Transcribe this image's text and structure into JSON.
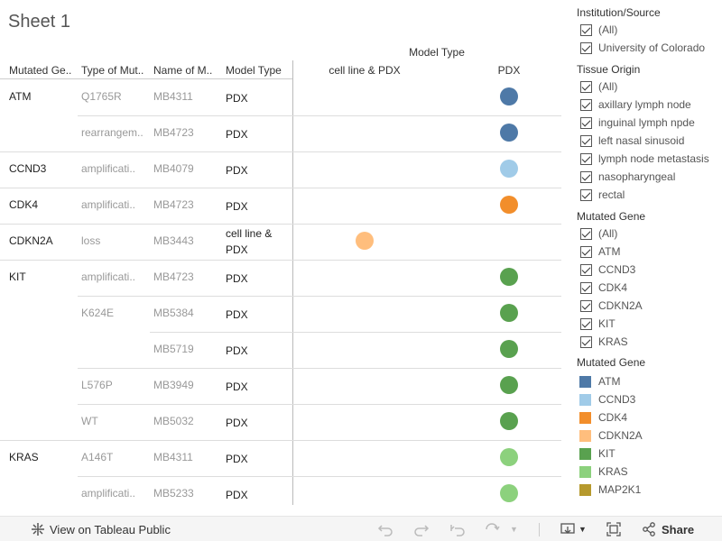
{
  "title": "Sheet 1",
  "column_header_top": "Model Type",
  "headers": {
    "gene": "Mutated Ge..",
    "mutation": "Type of Mut..",
    "name": "Name of M..",
    "model_type": "Model Type",
    "col_cell": "cell line & PDX",
    "col_pdx": "PDX"
  },
  "rows": [
    {
      "gene": "ATM",
      "mutation": "Q1765R",
      "name": "MB4311",
      "model_type": "PDX",
      "dot_col": "PDX",
      "color": "#4e79a7"
    },
    {
      "gene": "",
      "mutation": "rearrangem..",
      "name": "MB4723",
      "model_type": "PDX",
      "dot_col": "PDX",
      "color": "#4e79a7"
    },
    {
      "gene": "CCND3",
      "mutation": "amplificati..",
      "name": "MB4079",
      "model_type": "PDX",
      "dot_col": "PDX",
      "color": "#a0cbe8"
    },
    {
      "gene": "CDK4",
      "mutation": "amplificati..",
      "name": "MB4723",
      "model_type": "PDX",
      "dot_col": "PDX",
      "color": "#f28e2b"
    },
    {
      "gene": "CDKN2A",
      "mutation": "loss",
      "name": "MB3443",
      "model_type": "cell line & PDX",
      "dot_col": "cell",
      "color": "#ffbe7d"
    },
    {
      "gene": "KIT",
      "mutation": "amplificati..",
      "name": "MB4723",
      "model_type": "PDX",
      "dot_col": "PDX",
      "color": "#59a14f"
    },
    {
      "gene": "",
      "mutation": "K624E",
      "name": "MB5384",
      "model_type": "PDX",
      "dot_col": "PDX",
      "color": "#59a14f"
    },
    {
      "gene": "",
      "mutation": "",
      "name": "MB5719",
      "model_type": "PDX",
      "dot_col": "PDX",
      "color": "#59a14f"
    },
    {
      "gene": "",
      "mutation": "L576P",
      "name": "MB3949",
      "model_type": "PDX",
      "dot_col": "PDX",
      "color": "#59a14f"
    },
    {
      "gene": "",
      "mutation": "WT",
      "name": "MB5032",
      "model_type": "PDX",
      "dot_col": "PDX",
      "color": "#59a14f"
    },
    {
      "gene": "KRAS",
      "mutation": "A146T",
      "name": "MB4311",
      "model_type": "PDX",
      "dot_col": "PDX",
      "color": "#8cd17d"
    },
    {
      "gene": "",
      "mutation": "amplificati..",
      "name": "MB5233",
      "model_type": "PDX",
      "dot_col": "PDX",
      "color": "#8cd17d"
    }
  ],
  "filters": [
    {
      "title": "Institution/Source",
      "items": [
        "(All)",
        "University of Colorado"
      ]
    },
    {
      "title": "Tissue Origin",
      "items": [
        "(All)",
        "axillary lymph node",
        "inguinal lymph npde",
        "left nasal sinusoid",
        "lymph node metastasis",
        "nasopharyngeal",
        "rectal"
      ]
    },
    {
      "title": "Mutated Gene",
      "items": [
        "(All)",
        "ATM",
        "CCND3",
        "CDK4",
        "CDKN2A",
        "KIT",
        "KRAS"
      ]
    }
  ],
  "legend": {
    "title": "Mutated Gene",
    "items": [
      {
        "label": "ATM",
        "color": "#4e79a7"
      },
      {
        "label": "CCND3",
        "color": "#a0cbe8"
      },
      {
        "label": "CDK4",
        "color": "#f28e2b"
      },
      {
        "label": "CDKN2A",
        "color": "#ffbe7d"
      },
      {
        "label": "KIT",
        "color": "#59a14f"
      },
      {
        "label": "KRAS",
        "color": "#8cd17d"
      },
      {
        "label": "MAP2K1",
        "color": "#b6992d"
      }
    ]
  },
  "toolbar": {
    "view_label": "View on Tableau Public",
    "share_label": "Share"
  }
}
